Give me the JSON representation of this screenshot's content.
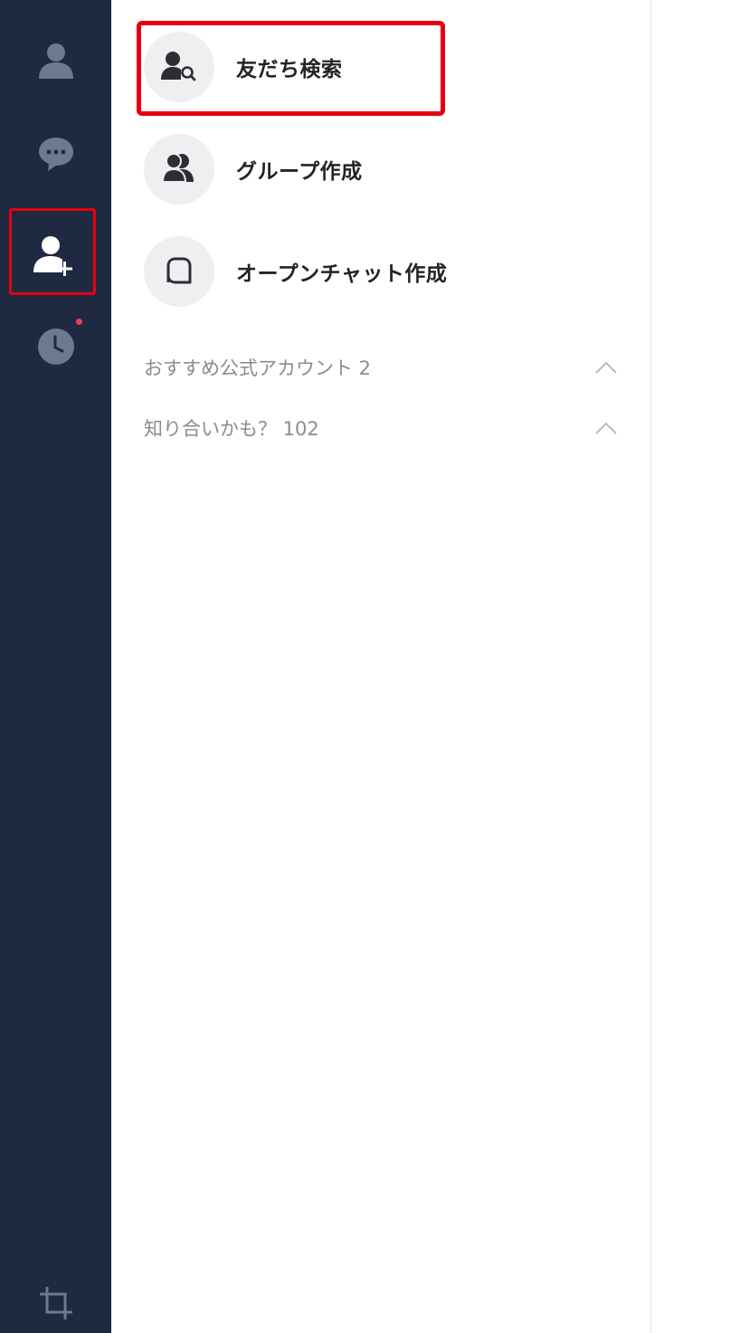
{
  "rail": {
    "icons": {
      "friends": "person-icon",
      "chats": "chat-bubble-icon",
      "add_friend": "add-friend-icon",
      "timeline": "clock-icon",
      "crop": "crop-icon"
    },
    "colors": {
      "background": "#1f2941",
      "icon": "#6d7891",
      "active_icon": "#ffffff",
      "notification_dot": "#e8415a",
      "highlight": "#e60012"
    }
  },
  "panel": {
    "menu": [
      {
        "label": "友だち検索",
        "icon": "friend-search-icon"
      },
      {
        "label": "グループ作成",
        "icon": "group-icon"
      },
      {
        "label": "オープンチャット作成",
        "icon": "open-chat-icon"
      }
    ],
    "sections": [
      {
        "label": "おすすめ公式アカウント 2",
        "icon": "chevron-up-icon"
      },
      {
        "label": "知り合いかも？ 102",
        "icon": "chevron-up-icon"
      }
    ]
  }
}
